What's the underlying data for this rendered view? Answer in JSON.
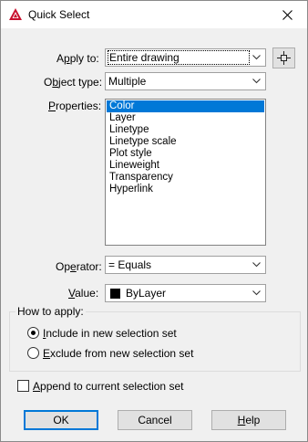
{
  "window": {
    "title": "Quick Select"
  },
  "apply_to": {
    "label_pre": "A",
    "label_ul": "p",
    "label_post": "ply to:",
    "value": "Entire drawing"
  },
  "object_type": {
    "label_pre": "O",
    "label_ul": "b",
    "label_post": "ject type:",
    "value": "Multiple"
  },
  "properties": {
    "label_pre": "",
    "label_ul": "P",
    "label_post": "roperties:",
    "items": [
      "Color",
      "Layer",
      "Linetype",
      "Linetype scale",
      "Plot style",
      "Lineweight",
      "Transparency",
      "Hyperlink"
    ],
    "selected_index": 0
  },
  "operator": {
    "label_pre": "Op",
    "label_ul": "e",
    "label_post": "rator:",
    "value": "= Equals"
  },
  "value_field": {
    "label_pre": "",
    "label_ul": "V",
    "label_post": "alue:",
    "value": "ByLayer",
    "swatch_color": "#000000"
  },
  "how_to_apply": {
    "legend": "How to apply:",
    "include": {
      "pre": "",
      "ul": "I",
      "post": "nclude in new selection set",
      "checked": true
    },
    "exclude": {
      "pre": "",
      "ul": "E",
      "post": "xclude from new selection set",
      "checked": false
    }
  },
  "append": {
    "pre": "",
    "ul": "A",
    "post": "ppend to current selection set",
    "checked": false
  },
  "buttons": {
    "ok": "OK",
    "cancel": "Cancel",
    "help_ul": "H",
    "help_post": "elp"
  },
  "colors": {
    "accent": "#0078d7",
    "app_icon": "#c8102e"
  }
}
